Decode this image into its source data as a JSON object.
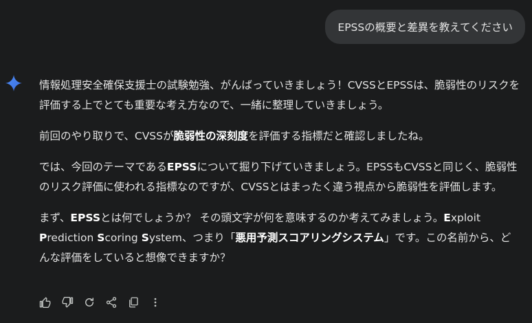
{
  "user_message": "EPSSの概要と差異を教えてください",
  "assistant": {
    "p1": "情報処理安全確保支援士の試験勉強、がんばっていきましょう！CVSSとEPSSは、脆弱性のリスクを評価する上でとても重要な考え方なので、一緒に整理していきましょう。",
    "p2": {
      "a": "前回のやり取りで、CVSSが",
      "b": "脆弱性の深刻度",
      "c": "を評価する指標だと確認しましたね。"
    },
    "p3": {
      "a": "では、今回のテーマである",
      "b": "EPSS",
      "c": "について掘り下げていきましょう。EPSSもCVSSと同じく、脆弱性のリスク評価に使われる指標なのですが、CVSSとはまったく違う視点から脆弱性を評価します。"
    },
    "p4": {
      "a": "まず、",
      "b": "EPSS",
      "c": "とは何でしょうか？ その頭文字が何を意味するのか考えてみましょう。",
      "e_bold": "E",
      "e_rest": "xploit ",
      "p_bold": "P",
      "p_rest": "rediction ",
      "s1_bold": "S",
      "s1_rest": "coring ",
      "s2_bold": "S",
      "s2_rest": "ystem、つまり「",
      "term": "悪用予測スコアリングシステム",
      "d": "」です。この名前から、どんな評価をしていると想像できますか？"
    }
  },
  "actions": [
    "thumbs-up-icon",
    "thumbs-down-icon",
    "regenerate-icon",
    "share-icon",
    "copy-icon",
    "more-options-icon"
  ],
  "colors": {
    "background": "#1b1c1d",
    "bubble": "#333537",
    "text": "#e3e3e3",
    "gemini_blue": "#4e8cf7"
  }
}
